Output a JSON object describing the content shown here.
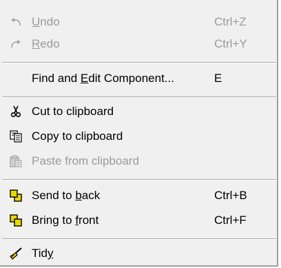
{
  "menu": {
    "undo": {
      "pre": "",
      "accel": "U",
      "post": "ndo",
      "shortcut": "Ctrl+Z"
    },
    "redo": {
      "pre": "",
      "accel": "R",
      "post": "edo",
      "shortcut": "Ctrl+Y"
    },
    "find": {
      "pre": "Find and ",
      "accel": "E",
      "post": "dit Component...",
      "shortcut": "E"
    },
    "cut": {
      "label": "Cut to clipboard"
    },
    "copy": {
      "label": "Copy to clipboard"
    },
    "paste": {
      "label": "Paste from clipboard"
    },
    "send_back": {
      "pre": "Send to ",
      "accel": "b",
      "post": "ack",
      "shortcut": "Ctrl+B"
    },
    "bring_front": {
      "pre": "Bring to ",
      "accel": "f",
      "post": "ront",
      "shortcut": "Ctrl+F"
    },
    "tidy": {
      "pre": "Tid",
      "accel": "y",
      "post": ""
    }
  },
  "icons": {
    "undo": "undo-arrow-icon",
    "redo": "redo-arrow-icon",
    "cut": "scissors-icon",
    "copy": "copy-clipboard-icon",
    "paste": "paste-clipboard-icon",
    "send_back": "send-to-back-icon",
    "bring_front": "bring-to-front-icon",
    "tidy": "broom-icon"
  },
  "colors": {
    "background": "#f0f0f0",
    "disabled_text": "#9a9a9a",
    "icon_yellow": "#e8d800"
  }
}
